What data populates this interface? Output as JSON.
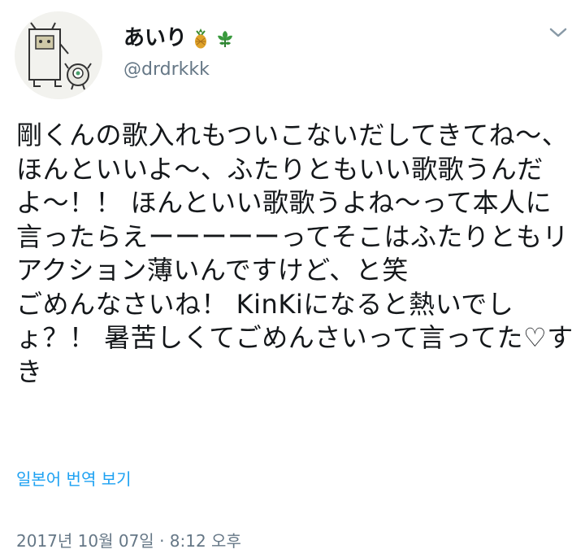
{
  "user": {
    "display_name": "あいり",
    "handle": "@drdrkkk",
    "name_emojis": [
      "pineapple-icon",
      "herb-icon"
    ]
  },
  "tweet": {
    "text": "剛くんの歌入れもついこないだしてきてね〜、ほんといいよ〜、ふたりともいい歌歌うんだよ〜！！ ほんといい歌歌うよね〜って本人に言ったらえーーーーーってそこはふたりともリアクション薄いんですけど、と笑\nごめんなさいね！ KinKiになると熱いでしょ？！ 暑苦しくてごめんさいって言ってた♡すき"
  },
  "translate_label": "일본어 번역 보기",
  "timestamp": "2017년 10월 07일 · 8:12 오후",
  "colors": {
    "link": "#1da1f2",
    "secondary_text": "#657786",
    "primary_text": "#14171a"
  }
}
